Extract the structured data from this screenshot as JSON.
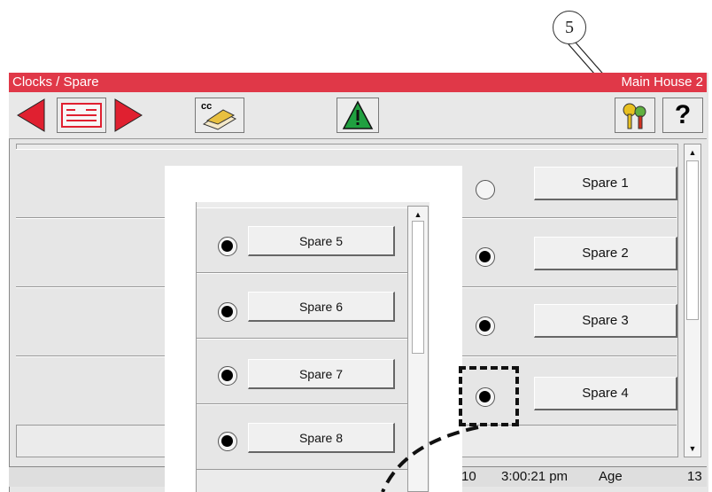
{
  "callout": {
    "number": "5"
  },
  "titlebar": {
    "left": "Clocks / Spare",
    "right": "Main House 2"
  },
  "toolbar": {
    "back_icon": "left-arrow-icon",
    "list_icon": "list-icon",
    "forward_icon": "right-arrow-icon",
    "cc_label": "cc",
    "alarm_icon": "warning-icon",
    "keys_icon": "keys-icon",
    "help_label": "?"
  },
  "rows": [
    {
      "label": "Spare 1",
      "selected": false
    },
    {
      "label": "Spare 2",
      "selected": true
    },
    {
      "label": "Spare 3",
      "selected": true
    },
    {
      "label": "Spare 4",
      "selected": true
    }
  ],
  "zoom_rows": [
    {
      "label": "Spare 5",
      "selected": true
    },
    {
      "label": "Spare 6",
      "selected": true
    },
    {
      "label": "Spare 7",
      "selected": true
    },
    {
      "label": "Spare 8",
      "selected": true
    }
  ],
  "statusbar": {
    "partial": "10",
    "time": "3:00:21 pm",
    "age_label": "Age",
    "age_value": "13"
  },
  "colors": {
    "titlebar": "#e03848",
    "arrow": "#e02030",
    "alarm": "#20a040"
  }
}
